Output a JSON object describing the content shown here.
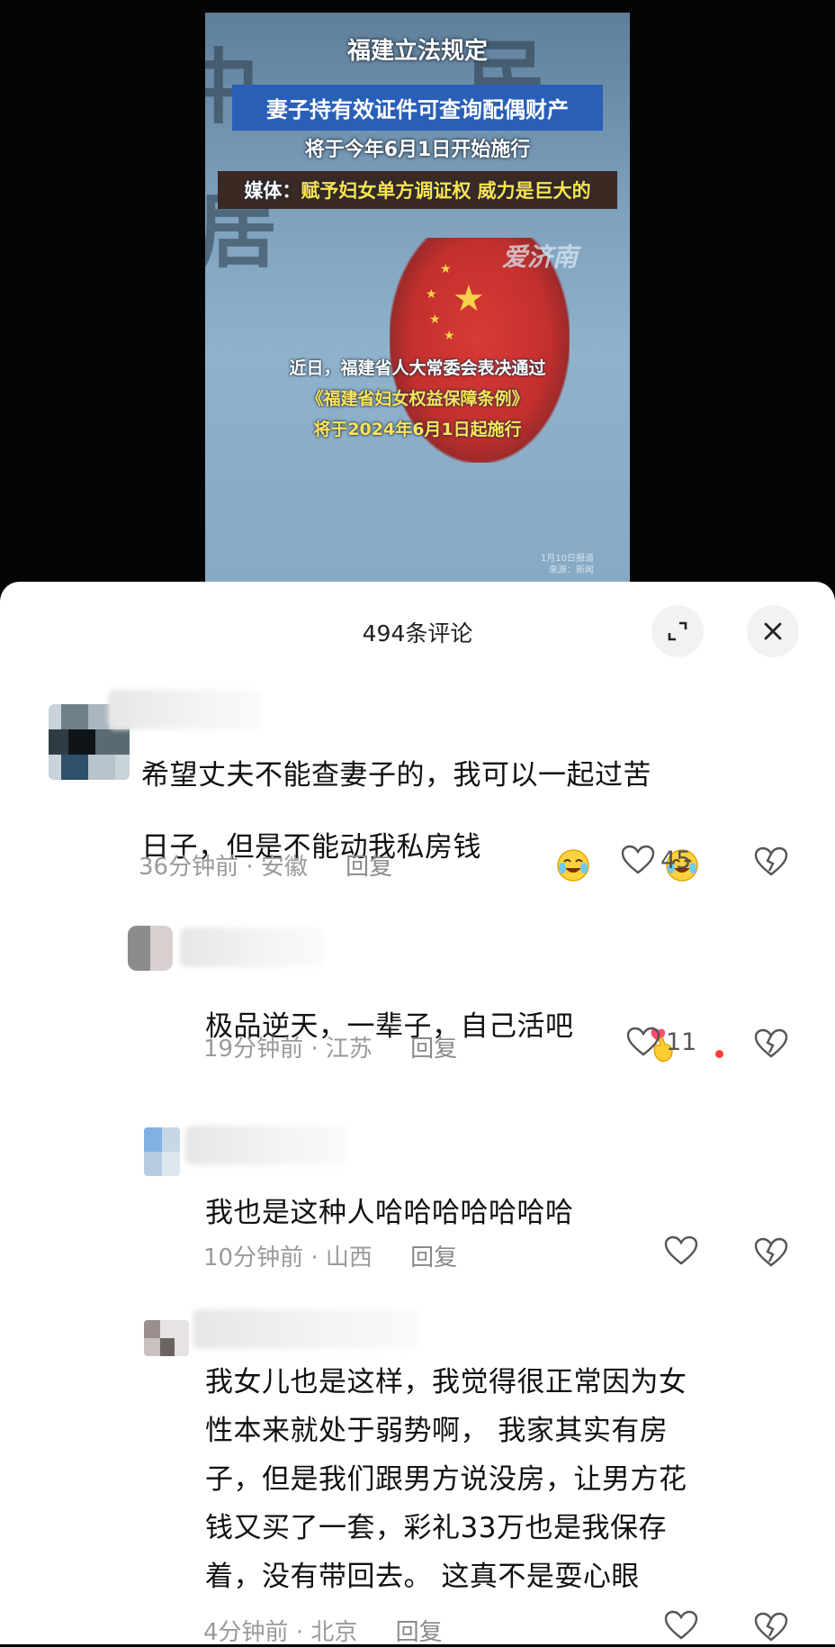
{
  "video": {
    "headline_title": "福建立法规定",
    "headline_blue": "妻子持有效证件可查询配偶财产",
    "headline_3": "将于今年6月1日开始施行",
    "headline_4_prefix": "媒体：",
    "headline_4_rest": "赋予妇女单方调证权 威力是巨大的",
    "watermark": "爱济南",
    "caption_1": "近日，福建省人大常委会表决通过",
    "caption_2": "《福建省妇女权益保障条例》",
    "caption_3": "将于2024年6月1日起施行",
    "stamp_1": "1月10日报道",
    "stamp_2": "来源：新闻"
  },
  "panel": {
    "count_title": "494条评论"
  },
  "comments": [
    {
      "text": "希望丈夫不能查妻子的，我可以一起过苦\n日子，但是不能动我私房钱",
      "time": "36分钟前",
      "region": "安徽",
      "reply": "回复",
      "likes": "45"
    },
    {
      "text": "极品逆天，一辈子，自己活吧",
      "time": "19分钟前",
      "region": "江苏",
      "reply": "回复",
      "likes": "11"
    },
    {
      "text": "我也是这种人哈哈哈哈哈哈哈",
      "time": "10分钟前",
      "region": "山西",
      "reply": "回复",
      "likes": ""
    },
    {
      "text": "我女儿也是这样，我觉得很正常因为女\n性本来就处于弱势啊， 我家其实有房\n子，但是我们跟男方说没房，让男方花\n钱又买了一套，彩礼33万也是我保存\n着，没有带回去。 这真不是耍心眼",
      "time": "4分钟前",
      "region": "北京",
      "reply": "回复",
      "likes": ""
    }
  ],
  "meta_separator": "·",
  "icons": {
    "expand": "expand-icon",
    "close": "close-icon",
    "like": "heart-icon",
    "dislike": "broken-heart-icon",
    "laugh": "laugh-cry-emoji",
    "heart_hand": "finger-heart-emoji"
  },
  "colors": {
    "panel_bg": "#ffffff",
    "meta_gray": "#9a9a9a",
    "headline_blue": "#2a5fb8",
    "seal_red": "#c2302e"
  }
}
